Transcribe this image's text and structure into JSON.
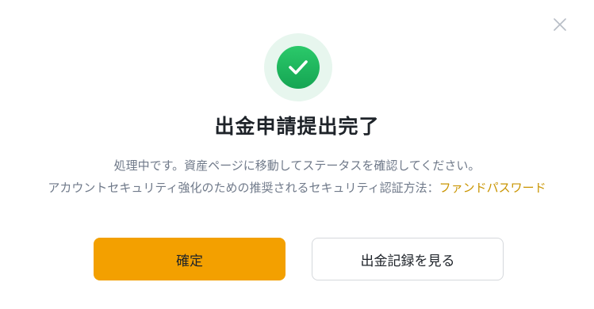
{
  "dialog": {
    "title": "出金申請提出完了",
    "message_line1": "処理中です。資産ページに移動してステータスを確認してください。",
    "message_line2_prefix": "アカウントセキュリティ強化のための推奨されるセキュリティ認証方法：",
    "message_line2_link": "ファンドパスワード",
    "confirm_label": "確定",
    "history_label": "出金記録を見る",
    "icons": {
      "close": "close-icon",
      "success": "checkmark-icon"
    },
    "colors": {
      "primary": "#f3a000",
      "success": "#1cb35c",
      "link": "#c99400"
    }
  }
}
